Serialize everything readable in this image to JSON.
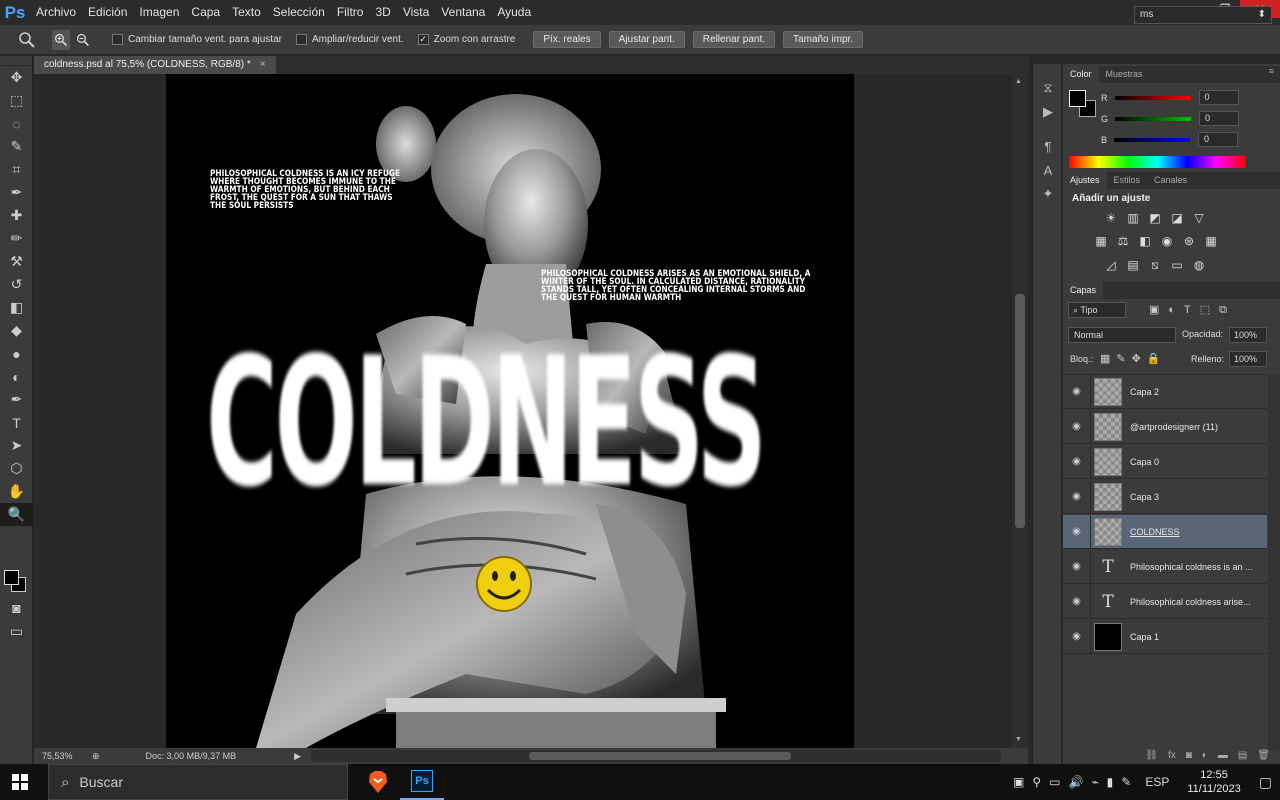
{
  "app": {
    "logo": "Ps"
  },
  "menu": [
    "Archivo",
    "Edición",
    "Imagen",
    "Capa",
    "Texto",
    "Selección",
    "Filtro",
    "3D",
    "Vista",
    "Ventana",
    "Ayuda"
  ],
  "window_controls": {
    "minimize": "—",
    "restore": "❐",
    "close": "✕"
  },
  "options": {
    "checkboxes": [
      {
        "label": "Cambiar tamaño vent. para ajustar",
        "checked": false
      },
      {
        "label": "Ampliar/reducir vent.",
        "checked": false
      },
      {
        "label": "Zoom con arrastre",
        "checked": true
      }
    ],
    "buttons": [
      "Píx. reales",
      "Ajustar pant.",
      "Rellenar pant.",
      "Tamaño impr."
    ],
    "workspace_value": "ms"
  },
  "document": {
    "tab_title": "coldness.psd al 75,5% (COLDNESS, RGB/8) *",
    "close_glyph": "×",
    "text1": "Philosophical coldness is an icy refuge where thought becomes immune to the warmth of emotions, but behind each frost, the quest for a sun that thaws the soul persists",
    "text2": "Philosophical coldness arises as an emotional shield, a winter of the soul. In calculated distance, rationality stands tall, yet often concealing internal storms and the quest for human warmth",
    "headline": "COLDNESS"
  },
  "status": {
    "zoom": "75,53%",
    "doc": "Doc: 3,00 MB/9,37 MB"
  },
  "tools": [
    "move-tool",
    "marquee-tool",
    "lasso-tool",
    "quick-select-tool",
    "crop-tool",
    "eyedropper-tool",
    "healing-tool",
    "brush-tool",
    "stamp-tool",
    "history-brush-tool",
    "eraser-tool",
    "paint-bucket-tool",
    "blur-tool",
    "dodge-tool",
    "pen-tool",
    "type-tool",
    "path-select-tool",
    "shape-tool",
    "hand-tool",
    "zoom-tool"
  ],
  "tool_glyphs": [
    "✥",
    "⬚",
    "◌",
    "✎",
    "⌗",
    "✒",
    "✚",
    "✏",
    "⚒",
    "↺",
    "◧",
    "◆",
    "●",
    "◐",
    "✒",
    "T",
    "➤",
    "⬡",
    "✋",
    "🔍"
  ],
  "color_panel": {
    "tabs": [
      "Color",
      "Muestras"
    ],
    "channels": [
      {
        "label": "R",
        "value": "0",
        "color": "#ff0000"
      },
      {
        "label": "G",
        "value": "0",
        "color": "#00c000"
      },
      {
        "label": "B",
        "value": "0",
        "color": "#0000ff"
      }
    ]
  },
  "adjust_panel": {
    "tabs": [
      "Ajustes",
      "Estilos",
      "Canales"
    ],
    "title": "Añadir un ajuste",
    "icons": [
      "brightness-icon",
      "levels-icon",
      "curves-icon",
      "exposure-icon",
      "vibrance-icon",
      "hue-sat-icon",
      "color-balance-icon",
      "bw-icon",
      "photo-filter-icon",
      "channel-mixer-icon",
      "color-lookup-icon",
      "invert-icon",
      "posterize-icon",
      "threshold-icon",
      "gradient-map-icon",
      "selective-color-icon"
    ]
  },
  "layers_panel": {
    "tab": "Capas",
    "filter": "Tipo",
    "blend_mode": "Normal",
    "opacity_label": "Opacidad:",
    "opacity": "100%",
    "lock_label": "Bloq.:",
    "fill_label": "Relleno:",
    "fill": "100%",
    "layers": [
      {
        "name": "Capa 2",
        "kind": "pixel",
        "selected": false
      },
      {
        "name": "@artprodesignerr (11)",
        "kind": "pixel",
        "selected": false
      },
      {
        "name": "Capa 0",
        "kind": "pixel",
        "selected": false
      },
      {
        "name": "Capa 3",
        "kind": "pixel",
        "selected": false
      },
      {
        "name": "COLDNESS",
        "kind": "smart",
        "selected": true
      },
      {
        "name": "Philosophical coldness is an ...",
        "kind": "text",
        "selected": false
      },
      {
        "name": "Philosophical coldness arise...",
        "kind": "text",
        "selected": false
      },
      {
        "name": "Capa 1",
        "kind": "fill",
        "selected": false
      }
    ]
  },
  "taskbar": {
    "search_placeholder": "Buscar",
    "lang": "ESP",
    "time": "12:55",
    "date": "11/11/2023"
  }
}
